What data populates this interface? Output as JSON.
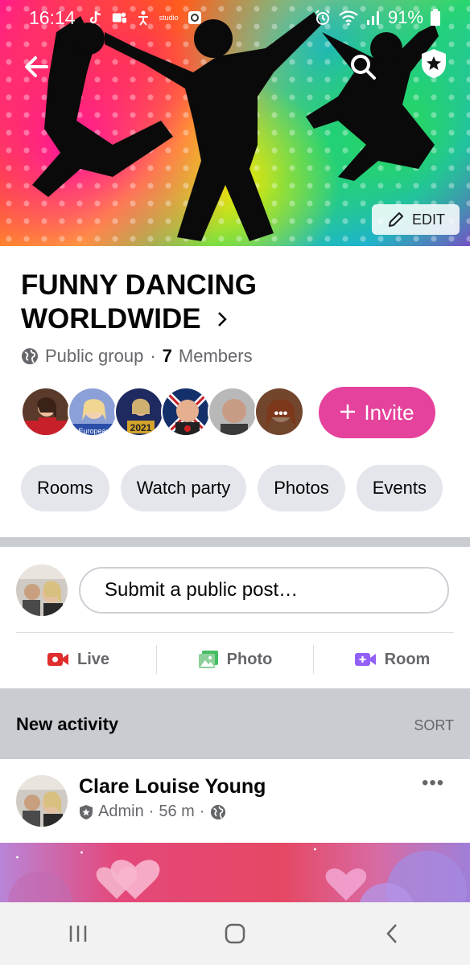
{
  "status_bar": {
    "time": "16:14",
    "notification_icons": [
      "tiktok-icon",
      "teams-icon",
      "accessibility-icon",
      "studio-icon",
      "app-icon"
    ],
    "studio_label": "studio",
    "battery": "91%"
  },
  "cover": {
    "edit_label": "EDIT"
  },
  "group": {
    "name": "FUNNY DANCING WORLDWIDE",
    "privacy": "Public group",
    "separator": "·",
    "member_count": "7",
    "members_label": "Members",
    "invite_label": "Invite",
    "member_avatars": [
      "#7a3b2e",
      "#4b6ea8",
      "#2a3a7a",
      "#6a2020",
      "#8f8f8f",
      "#b06a45"
    ],
    "more_avatar_label": "•••",
    "avatar_badges": [
      "",
      "European",
      "2021",
      "",
      "",
      ""
    ]
  },
  "chips": [
    "Rooms",
    "Watch party",
    "Photos",
    "Events"
  ],
  "composer": {
    "placeholder": "Submit a public post…",
    "actions": [
      {
        "label": "Live",
        "color": "#e02d2d"
      },
      {
        "label": "Photo",
        "color": "#45bd62"
      },
      {
        "label": "Room",
        "color": "#9360f7"
      }
    ]
  },
  "activity": {
    "title": "New activity",
    "sort_label": "SORT"
  },
  "post": {
    "author": "Clare Louise Young",
    "role": "Admin",
    "time": "56 m",
    "more": "•••"
  },
  "colors": {
    "accent": "#e4429c",
    "chip_bg": "#e4e6eb",
    "divider": "#c9ccd1"
  }
}
